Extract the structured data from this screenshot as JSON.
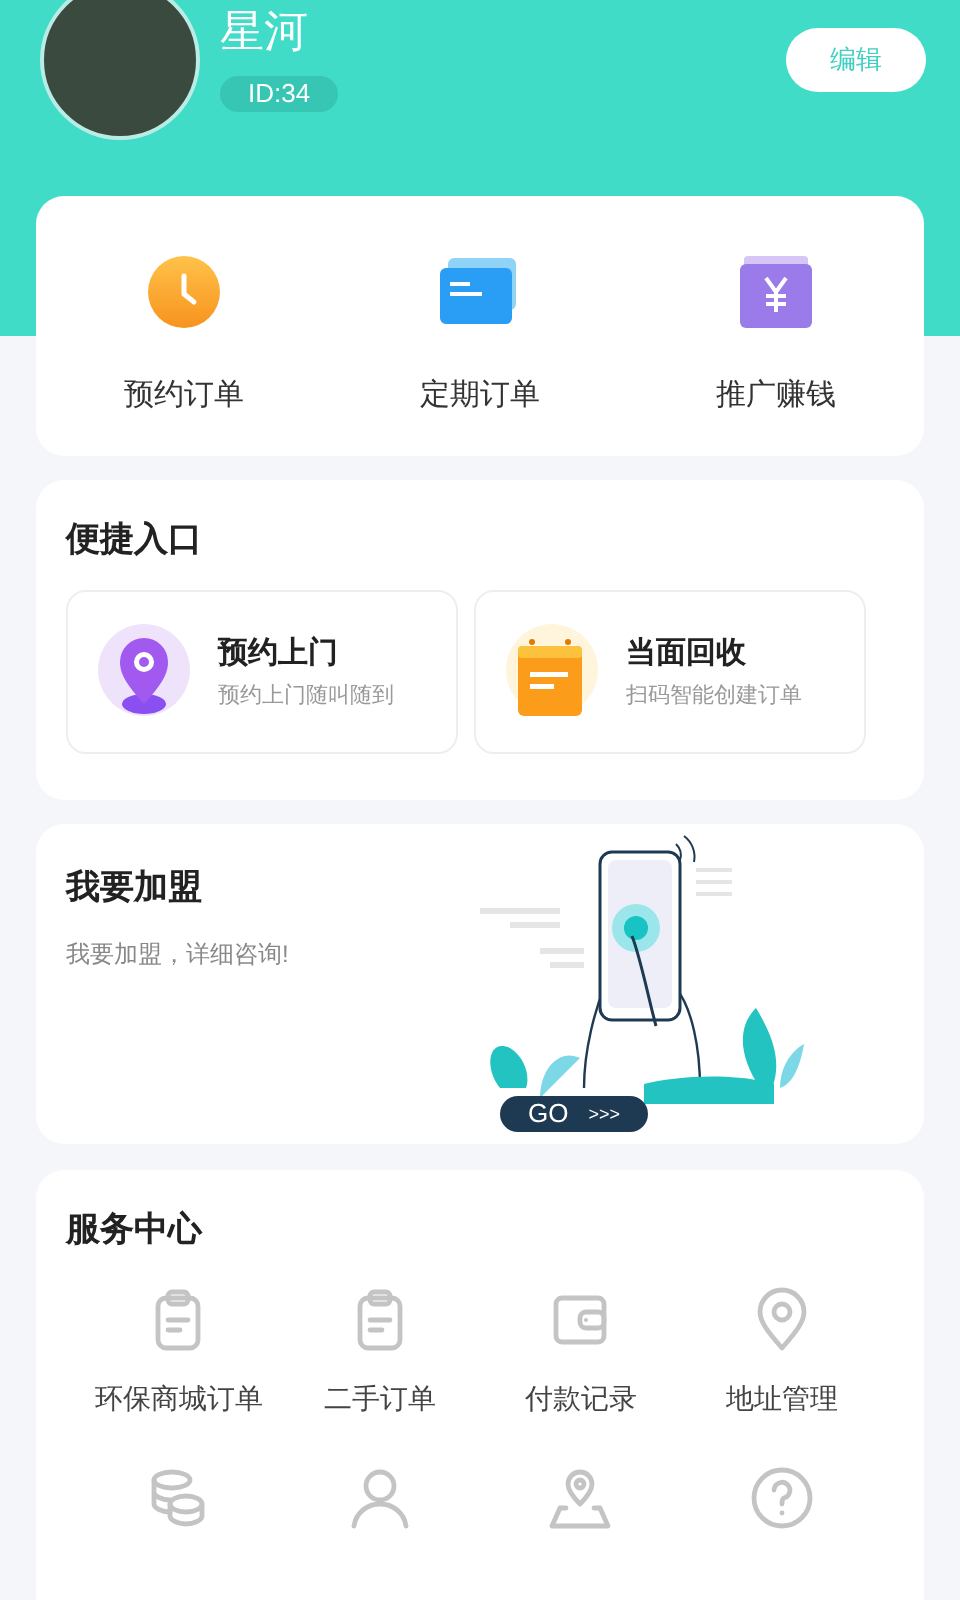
{
  "profile": {
    "name": "星河",
    "id_badge": "ID:34",
    "edit_button": "编辑"
  },
  "orders": [
    {
      "label": "预约订单"
    },
    {
      "label": "定期订单"
    },
    {
      "label": "推广赚钱"
    }
  ],
  "shortcuts": {
    "title": "便捷入口",
    "items": [
      {
        "title": "预约上门",
        "subtitle": "预约上门随叫随到"
      },
      {
        "title": "当面回收",
        "subtitle": "扫码智能创建订单"
      }
    ]
  },
  "franchise": {
    "title": "我要加盟",
    "subtitle": "我要加盟，详细咨询!",
    "go_label": "GO",
    "go_arrows": ">>>"
  },
  "services": {
    "title": "服务中心",
    "items": [
      {
        "label": "环保商城订单"
      },
      {
        "label": "二手订单"
      },
      {
        "label": "付款记录"
      },
      {
        "label": "地址管理"
      }
    ]
  }
}
